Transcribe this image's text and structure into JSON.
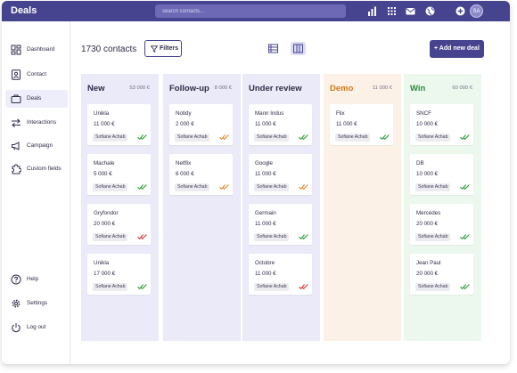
{
  "app": {
    "title": "Deals"
  },
  "search": {
    "placeholder": "search contacts..."
  },
  "user": {
    "initials": "SA"
  },
  "topbar_icons": [
    "bar-chart-icon",
    "apps-grid-icon",
    "mail-icon",
    "globe-icon",
    "plus-circle-icon"
  ],
  "sidebar": {
    "items": [
      {
        "label": "Dashboard",
        "icon": "dashboard-icon",
        "active": false
      },
      {
        "label": "Contact",
        "icon": "contact-icon",
        "active": false
      },
      {
        "label": "Deals",
        "icon": "briefcase-icon",
        "active": true
      },
      {
        "label": "Interactions",
        "icon": "interactions-icon",
        "active": false
      },
      {
        "label": "Campaign",
        "icon": "megaphone-icon",
        "active": false
      },
      {
        "label": "Custom fields",
        "icon": "puzzle-icon",
        "active": false
      }
    ],
    "bottom_items": [
      {
        "label": "Help",
        "icon": "help-icon"
      },
      {
        "label": "Settings",
        "icon": "settings-icon"
      },
      {
        "label": "Log out",
        "icon": "power-icon"
      }
    ]
  },
  "toolbar": {
    "contacts_count": "1730 contacts",
    "filters_label": "Filters",
    "add_deal_label": "+ Add new deal"
  },
  "colors": {
    "brand": "#47448f",
    "check_green": "#2e9e3c",
    "check_orange": "#e08a2a",
    "check_red": "#d63a3a"
  },
  "columns": [
    {
      "title": "New",
      "total": "53 000 €",
      "title_color": "#2c2c48",
      "bg": "#eaeaf8",
      "cards": [
        {
          "name": "Unikla",
          "amount": "11 000 €",
          "owner": "Sofiane Achab",
          "status": "green"
        },
        {
          "name": "Machale",
          "amount": "5 000 €",
          "owner": "Sofiane Achab",
          "status": "green"
        },
        {
          "name": "Gryfondor",
          "amount": "20 000 €",
          "owner": "Sofiane Achab",
          "status": "red"
        },
        {
          "name": "Unikla",
          "amount": "17 000 €",
          "owner": "Sofiane Achab",
          "status": "green"
        }
      ]
    },
    {
      "title": "Follow-up",
      "total": "8 000 €",
      "title_color": "#2c2c48",
      "bg": "#eaeaf8",
      "cards": [
        {
          "name": "Notidy",
          "amount": "2 000 €",
          "owner": "Sofiane Achab",
          "status": "orange"
        },
        {
          "name": "Netflix",
          "amount": "6 000 €",
          "owner": "Sofiane Achab",
          "status": "orange"
        }
      ]
    },
    {
      "title": "Under review",
      "total": "",
      "title_color": "#2c2c48",
      "bg": "#eaeaf8",
      "cards": [
        {
          "name": "Mann Indus",
          "amount": "11 000 €",
          "owner": "Sofiane Achab",
          "status": "green"
        },
        {
          "name": "Google",
          "amount": "11 000 €",
          "owner": "Sofiane Achab",
          "status": "orange"
        },
        {
          "name": "Germain",
          "amount": "11 000 €",
          "owner": "Sofiane Achab",
          "status": "green"
        },
        {
          "name": "Octobre",
          "amount": "11 000 €",
          "owner": "Sofiane Achab",
          "status": "red"
        }
      ]
    },
    {
      "title": "Demo",
      "total": "11 000 €",
      "title_color": "#d07a16",
      "bg": "#fcf1e6",
      "cards": [
        {
          "name": "Flix",
          "amount": "11 000 €",
          "owner": "Sofiane Achab",
          "status": "green"
        }
      ]
    },
    {
      "title": "Win",
      "total": "60 000 €",
      "title_color": "#2a8a3a",
      "bg": "#ecf8ee",
      "cards": [
        {
          "name": "SNCF",
          "amount": "10 000 €",
          "owner": "Sofiane Achab",
          "status": "green"
        },
        {
          "name": "DB",
          "amount": "10 000 €",
          "owner": "Sofiane Achab",
          "status": "green"
        },
        {
          "name": "Mercedes",
          "amount": "20 000 €",
          "owner": "Sofiane Achab",
          "status": "green"
        },
        {
          "name": "Jean Paul",
          "amount": "20 000 €",
          "owner": "Sofiane Achab",
          "status": "green"
        }
      ]
    }
  ]
}
